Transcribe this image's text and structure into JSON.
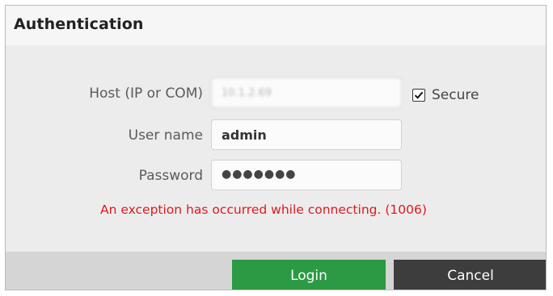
{
  "dialog": {
    "title": "Authentication"
  },
  "form": {
    "host_label": "Host (IP or COM)",
    "host_value": "10.1.2.69",
    "secure_label": "Secure",
    "secure_checked": true,
    "username_label": "User name",
    "username_value": "admin",
    "password_label": "Password",
    "password_mask": "●●●●●●●"
  },
  "error": {
    "message": "An exception has occurred while connecting. (1006)",
    "color": "#e0181e"
  },
  "buttons": {
    "login": "Login",
    "cancel": "Cancel"
  },
  "colors": {
    "login_button": "#2c9a45",
    "cancel_button": "#3d3d3d"
  }
}
